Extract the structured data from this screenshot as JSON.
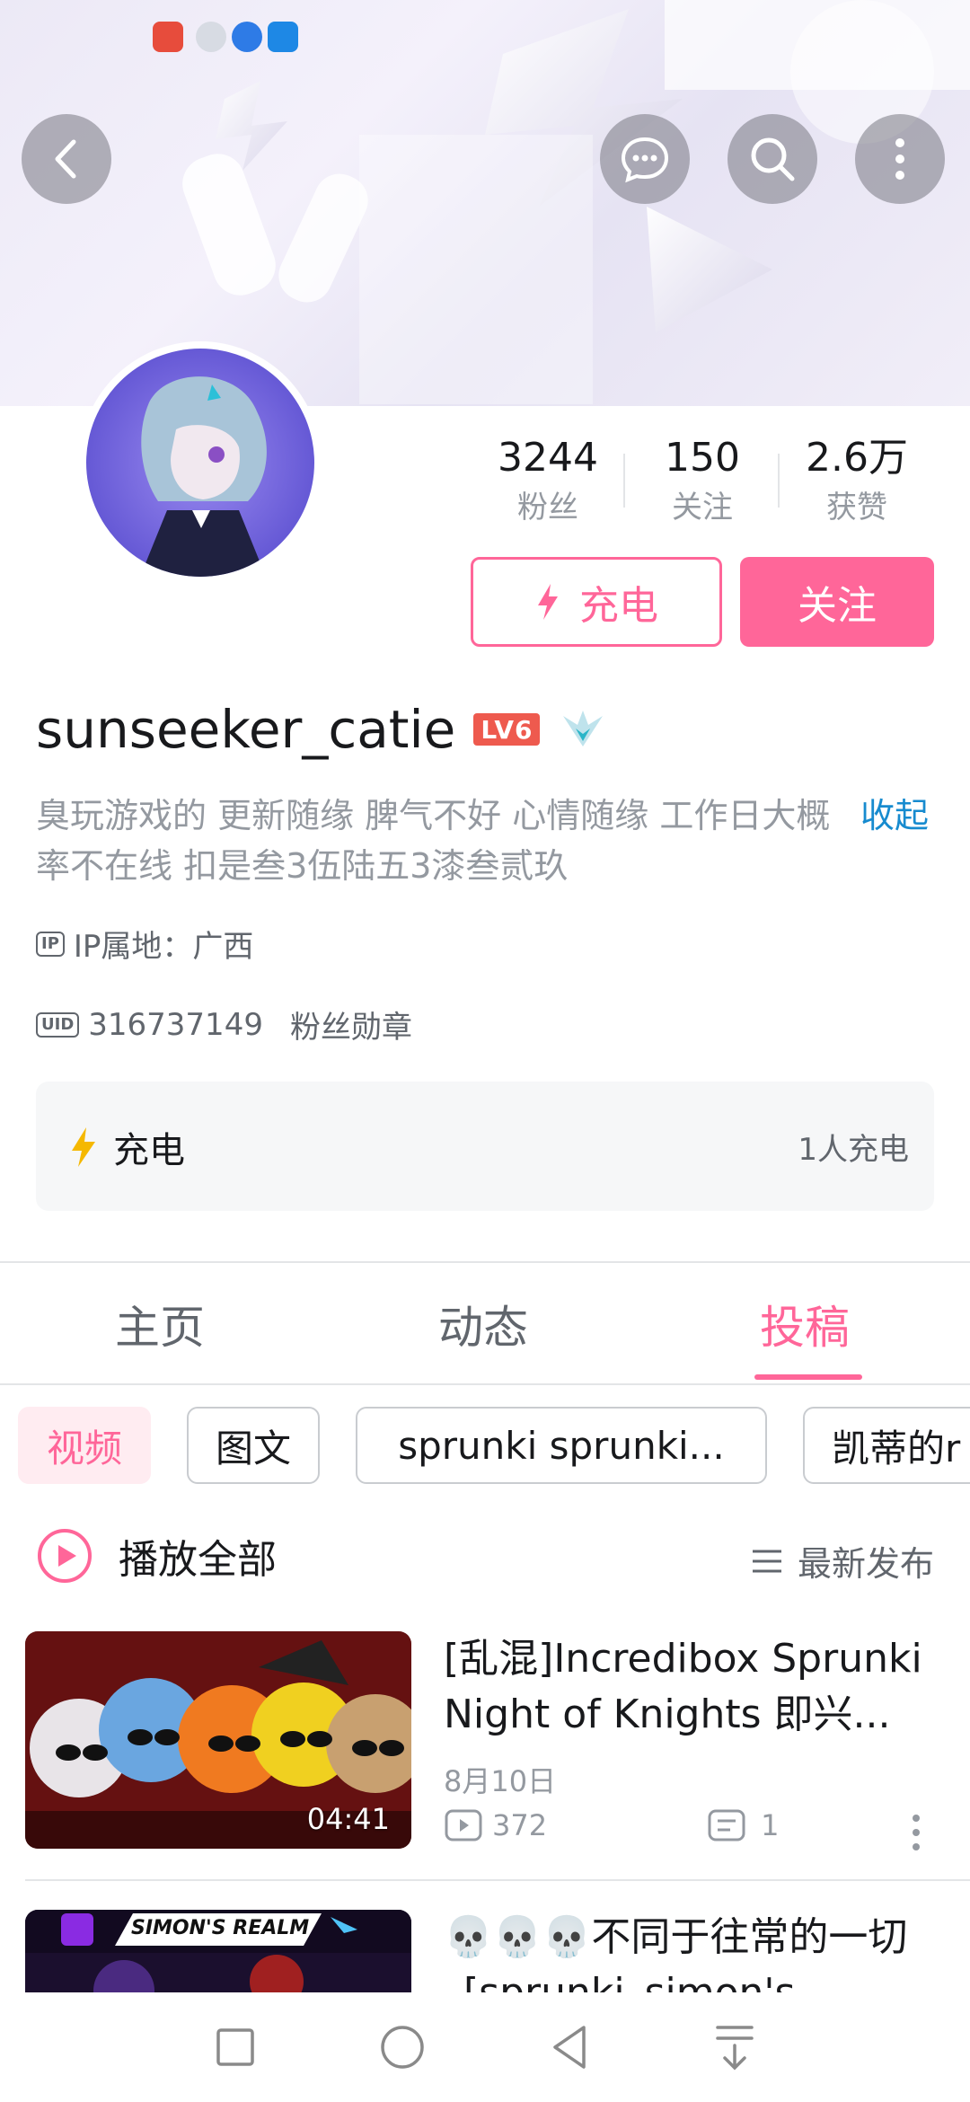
{
  "profile": {
    "username": "sunseeker_catie",
    "level_badge": "LV6",
    "bio": "臭玩游戏的 更新随缘 脾气不好 心情随缘 工作日大概率不在线 扣是叁3伍陆五3漆叁贰玖",
    "collapse_label": "收起",
    "ip_location": "IP属地：广西",
    "uid": "316737149",
    "fan_medal_label": "粉丝勋章"
  },
  "stats": {
    "followers_value": "3244",
    "followers_label": "粉丝",
    "following_value": "150",
    "following_label": "关注",
    "likes_value": "2.6万",
    "likes_label": "获赞"
  },
  "actions": {
    "charge_label": "充电",
    "follow_label": "关注"
  },
  "charge_card": {
    "label": "充电",
    "count_text": "1人充电"
  },
  "tabs": [
    {
      "label": "主页"
    },
    {
      "label": "动态"
    },
    {
      "label": "投稿"
    }
  ],
  "active_tab": "投稿",
  "chips": [
    {
      "label": "视频"
    },
    {
      "label": "图文"
    },
    {
      "label": "sprunki sprunki..."
    },
    {
      "label": "凯蒂的r"
    }
  ],
  "list_header": {
    "play_all": "播放全部",
    "sort": "最新发布"
  },
  "videos": [
    {
      "title": "[乱混]Incredibox Sprunki Night of Knights 即兴...",
      "date": "8月10日",
      "duration": "04:41",
      "plays": "372",
      "comments": "1"
    },
    {
      "title": "💀💀💀不同于往常的一切_[sprunki_simon's",
      "thumb_text": "SIMON'S REALM"
    }
  ],
  "colors": {
    "accent": "#ff6699",
    "link": "#178bcf",
    "bolt": "#f5b800"
  }
}
